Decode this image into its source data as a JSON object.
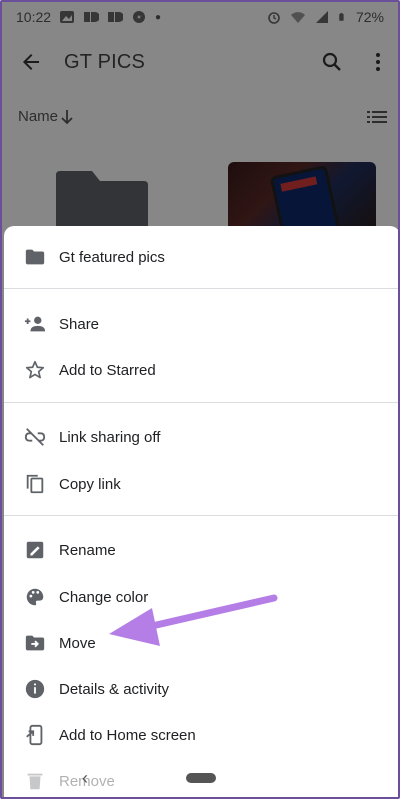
{
  "status_bar": {
    "time": "10:22",
    "battery": "72%"
  },
  "app_bar": {
    "title": "GT PICS"
  },
  "sort": {
    "label": "Name"
  },
  "sheet": {
    "header_title": "Gt featured pics",
    "items": [
      {
        "label": "Share",
        "icon": "person-add-icon"
      },
      {
        "label": "Add to Starred",
        "icon": "star-icon"
      },
      {
        "label": "Link sharing off",
        "icon": "link-off-icon"
      },
      {
        "label": "Copy link",
        "icon": "copy-icon"
      },
      {
        "label": "Rename",
        "icon": "rename-icon"
      },
      {
        "label": "Change color",
        "icon": "palette-icon"
      },
      {
        "label": "Move",
        "icon": "move-to-folder-icon"
      },
      {
        "label": "Details & activity",
        "icon": "info-icon"
      },
      {
        "label": "Add to Home screen",
        "icon": "add-to-home-icon"
      },
      {
        "label": "Remove",
        "icon": "trash-icon"
      }
    ]
  },
  "colors": {
    "arrow": "#b57ee6",
    "scrim": "#000000",
    "text": "#202124"
  }
}
